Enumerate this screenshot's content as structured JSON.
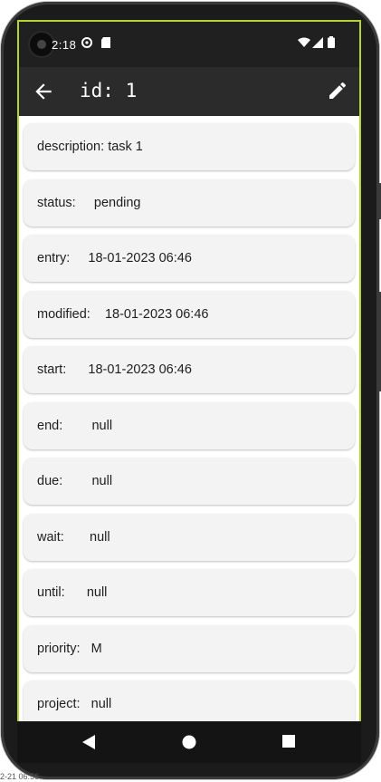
{
  "statusbar": {
    "time": "2:18"
  },
  "appbar": {
    "title": "id: 1"
  },
  "fields": [
    {
      "label": "description:",
      "value": "task 1",
      "gap": " "
    },
    {
      "label": "status:",
      "value": "pending",
      "gap": "     "
    },
    {
      "label": "entry:",
      "value": "18-01-2023 06:46",
      "gap": "     "
    },
    {
      "label": "modified:",
      "value": "18-01-2023 06:46",
      "gap": "    "
    },
    {
      "label": "start:",
      "value": "18-01-2023 06:46",
      "gap": "      "
    },
    {
      "label": "end:",
      "value": "null",
      "gap": "        "
    },
    {
      "label": "due:",
      "value": "null",
      "gap": "        "
    },
    {
      "label": "wait:",
      "value": "null",
      "gap": "       "
    },
    {
      "label": "until:",
      "value": "null",
      "gap": "      "
    },
    {
      "label": "priority:",
      "value": "M",
      "gap": "   "
    },
    {
      "label": "project:",
      "value": "null",
      "gap": "   "
    }
  ],
  "footer": {
    "text": "2-21 06:56"
  },
  "colors": {
    "accent": "#b5d334",
    "appbar": "#2b2b2b",
    "card": "#f3f3f3"
  }
}
